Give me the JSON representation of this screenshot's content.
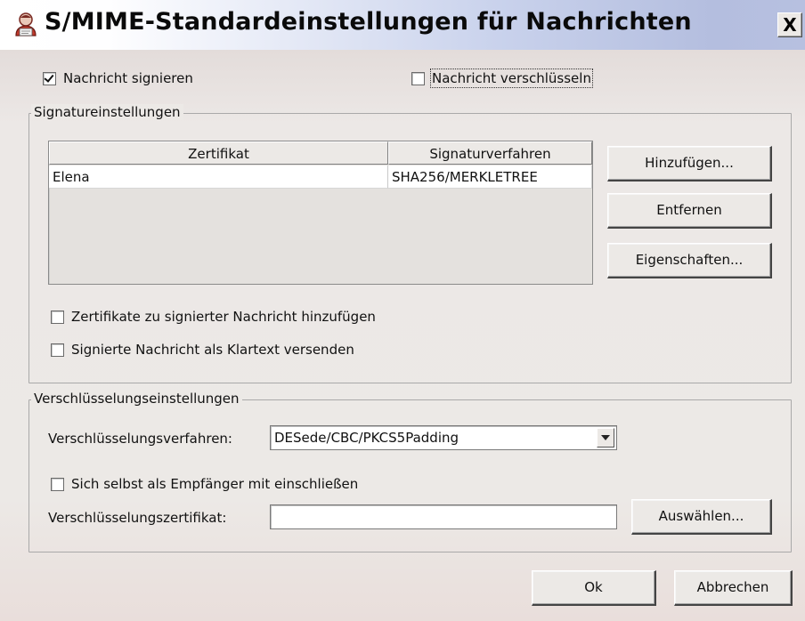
{
  "window": {
    "title": "S/MIME-Standardeinstellungen für Nachrichten",
    "close_label": "X",
    "icon": "smime-certificate-icon"
  },
  "options": {
    "sign": {
      "label": "Nachricht signieren",
      "checked": true
    },
    "encrypt": {
      "label": "Nachricht verschlüsseln",
      "checked": false
    }
  },
  "signature": {
    "legend": "Signatureinstellungen",
    "table": {
      "columns": [
        "Zertifikat",
        "Signaturverfahren"
      ],
      "rows": [
        [
          "Elena",
          "SHA256/MERKLETREE"
        ]
      ]
    },
    "buttons": {
      "add": "Hinzufügen...",
      "remove": "Entfernen",
      "properties": "Eigenschaften..."
    },
    "add_certs": {
      "label": "Zertifikate zu signierter Nachricht hinzufügen",
      "checked": false
    },
    "cleartext": {
      "label": "Signierte Nachricht als Klartext versenden",
      "checked": false
    }
  },
  "encryption": {
    "legend": "Verschlüsselungseinstellungen",
    "method_label": "Verschlüsselungsverfahren:",
    "method_value": "DESede/CBC/PKCS5Padding",
    "include_self": {
      "label": "Sich selbst als Empfänger mit einschließen",
      "checked": false
    },
    "cert_label": "Verschlüsselungszertifikat:",
    "cert_value": "",
    "select_button": "Auswählen..."
  },
  "footer": {
    "ok": "Ok",
    "cancel": "Abbrechen"
  }
}
